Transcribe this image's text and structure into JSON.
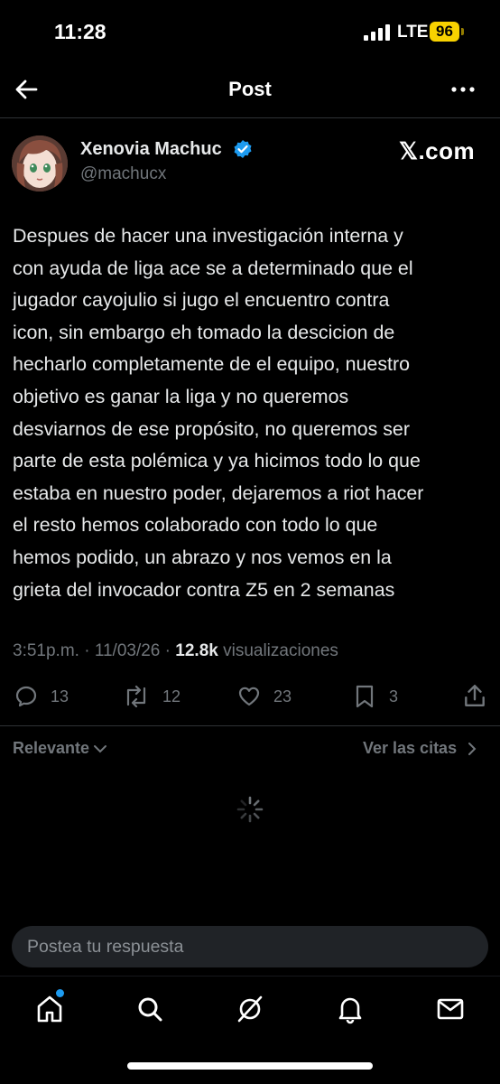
{
  "status_bar": {
    "time": "11:28",
    "network": "LTE",
    "battery": "96",
    "battery_color": "#f8d200"
  },
  "nav": {
    "title": "Post",
    "back_icon": "arrow-left-icon",
    "more_icon": "more-horizontal-icon"
  },
  "post": {
    "author_name": "Xenovia Machuc",
    "author_handle": "@machucx",
    "source_label": "𝕏.com",
    "text": "Despues de hacer una investigación interna y\ncon ayuda de liga ace se a determinado que el\njugador cayojulio si jugo el encuentro contra\nicon, sin embargo eh tomado la descicion de\nhecharlo completamente de el equipo, nuestro\nobjetivo es ganar la liga y no queremos\ndesviarnos de ese propósito, no queremos ser\nparte de esta polémica y ya hicimos todo lo que\nestaba en nuestro poder, dejaremos a riot hacer\nel resto hemos colaborado con todo lo que\nhemos podido, un abrazo y nos vemos en la\ngrieta del invocador contra Z5 en 2 semanas",
    "time": "3:51p.m.",
    "date": "11/03/26",
    "views_count": "12.8k",
    "views_label": "visualizaciones"
  },
  "actions": {
    "replies": "13",
    "reposts": "12",
    "likes": "23",
    "bookmarks": "3"
  },
  "filters": {
    "sort_label": "Relevante",
    "quotes_label": "Ver las citas"
  },
  "reply": {
    "placeholder": "Postea tu respuesta"
  },
  "tabs": [
    {
      "icon": "home-icon",
      "has_notification_dot": true
    },
    {
      "icon": "search-icon"
    },
    {
      "icon": "grok-icon"
    },
    {
      "icon": "bell-icon"
    },
    {
      "icon": "mail-icon"
    }
  ],
  "colors": {
    "accent": "#1d9bf0",
    "muted_text": "#71767b",
    "background": "#000000"
  }
}
